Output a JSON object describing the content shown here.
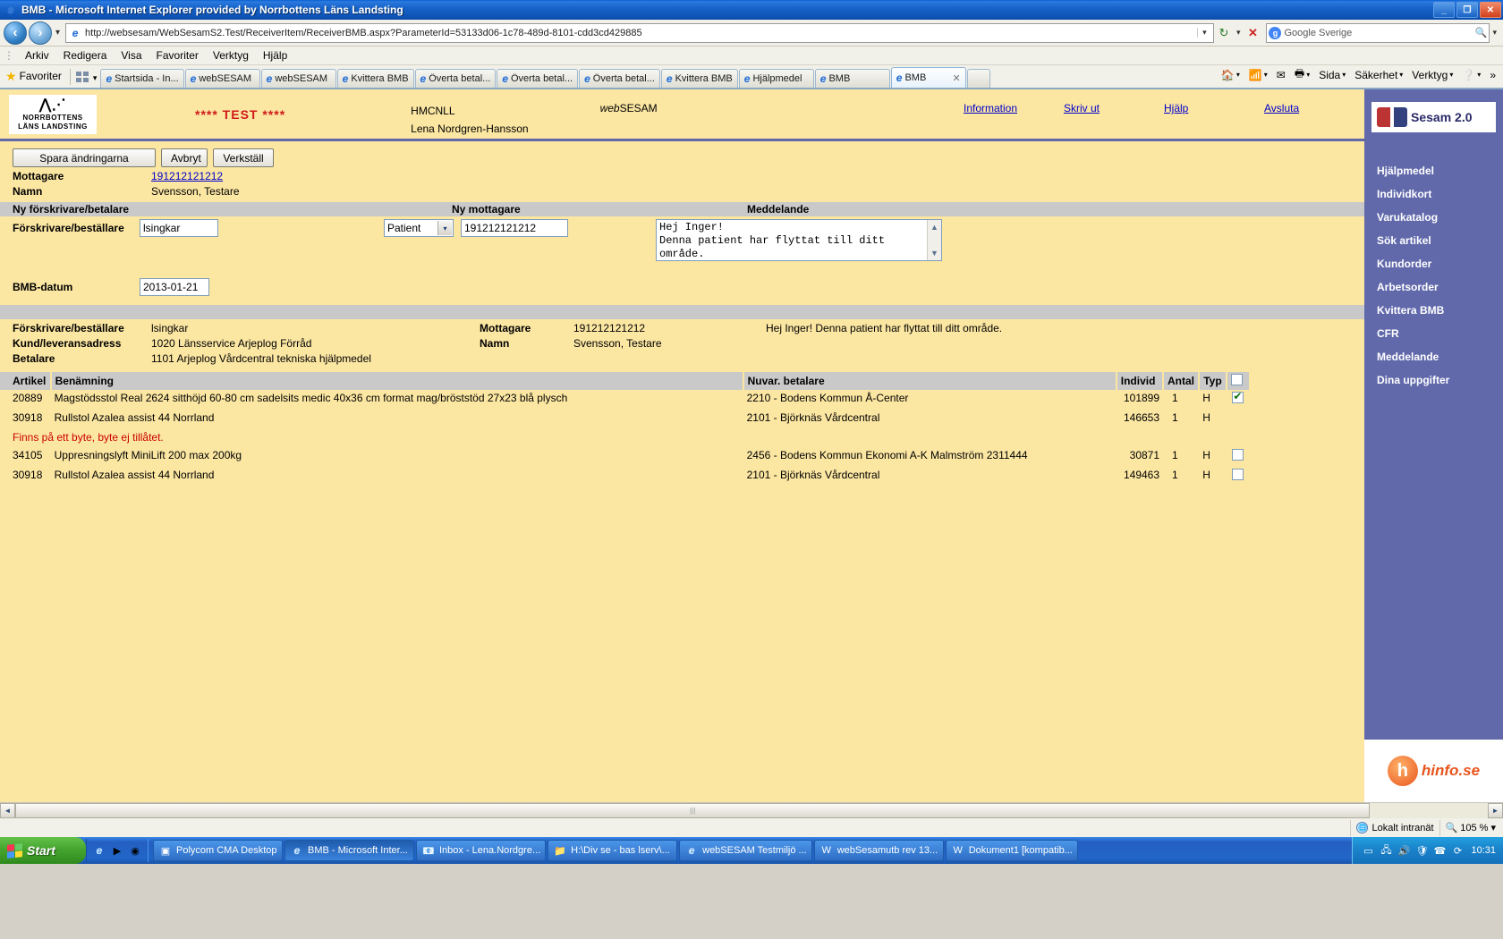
{
  "window": {
    "title": "BMB - Microsoft Internet Explorer provided by Norrbottens Läns Landsting",
    "icon": "ie-icon",
    "minimize": "_",
    "maximize": "❐",
    "close": "✕"
  },
  "address_bar": {
    "back_icon": "back-arrow-icon",
    "forward_icon": "forward-arrow-icon",
    "history_caret": "▾",
    "url": "http://websesam/WebSesamS2.Test/ReceiverItem/ReceiverBMB.aspx?ParameterId=53133d06-1c78-489d-8101-cdd3cd429885",
    "url_chevron": "▾",
    "refresh_icon": "refresh-icon",
    "stop_icon": "✕",
    "search_placeholder": "Google Sverige",
    "search_engine_badge": "g",
    "search_icon": "🔍"
  },
  "menu": {
    "items": [
      "Arkiv",
      "Redigera",
      "Visa",
      "Favoriter",
      "Verktyg",
      "Hjälp"
    ]
  },
  "favorites_bar": {
    "label": "Favoriter",
    "star_icon": "star-icon",
    "grid_icon": "grid-icon",
    "caret": "▾"
  },
  "tabs": [
    {
      "label": "Startsida - In...",
      "active": false
    },
    {
      "label": "webSESAM",
      "active": false
    },
    {
      "label": "webSESAM",
      "active": false
    },
    {
      "label": "Kvittera BMB",
      "active": false
    },
    {
      "label": "Överta betal...",
      "active": false
    },
    {
      "label": "Överta betal...",
      "active": false
    },
    {
      "label": "Överta betal...",
      "active": false
    },
    {
      "label": "Kvittera BMB",
      "active": false
    },
    {
      "label": "Hjälpmedel",
      "active": false
    },
    {
      "label": "BMB",
      "active": false
    },
    {
      "label": "BMB",
      "active": true,
      "close": "✕"
    }
  ],
  "tab_toolbar": {
    "home_icon": "home-icon",
    "feeds_icon": "rss-icon",
    "mail_icon": "mail-icon",
    "print_icon": "printer-icon",
    "caret": "▾",
    "page_menu": "Sida",
    "safety_menu": "Säkerhet",
    "tools_menu": "Verktyg",
    "help_icon": "help-icon",
    "overflow": "»"
  },
  "app_header": {
    "logo_line1": "NORRBOTTENS",
    "logo_line2": "LÄNS LANDSTING",
    "test_banner": "**** TEST ****",
    "org_code": "HMCNLL",
    "user_name": "Lena Nordgren-Hansson",
    "product_prefix": "web",
    "product_suffix": "SESAM",
    "links": [
      "Information",
      "Skriv ut",
      "Hjälp",
      "Avsluta"
    ]
  },
  "toolbar": {
    "save_label": "Spara ändringarna",
    "cancel_label": "Avbryt",
    "apply_label": "Verkställ"
  },
  "receiver": {
    "mottagare_label": "Mottagare",
    "mottagare_value": "191212121212",
    "namn_label": "Namn",
    "namn_value": "Svensson, Testare"
  },
  "section_headers": {
    "new_prescriber": "Ny förskrivare/betalare",
    "new_receiver": "Ny mottagare",
    "message": "Meddelande"
  },
  "form": {
    "prescriber_label": "Förskrivare/beställare",
    "prescriber_value": "lsingkar",
    "receiver_type_value": "Patient",
    "receiver_type_options": [
      "Patient"
    ],
    "receiver_id_value": "191212121212",
    "message_value": "Hej Inger!\nDenna patient har flyttat till ditt\nområde.",
    "bmb_date_label": "BMB-datum",
    "bmb_date_value": "2013-01-21",
    "select_caret": "▾",
    "scroll_up": "▲",
    "scroll_down": "▼"
  },
  "summary": {
    "prescriber_label": "Förskrivare/beställare",
    "prescriber_value": "lsingkar",
    "customer_label": "Kund/leveransadress",
    "customer_value": "1020 Länsservice Arjeplog Förråd",
    "payer_label": "Betalare",
    "payer_value": "1101 Arjeplog Vårdcentral tekniska hjälpmedel",
    "receiver_label": "Mottagare",
    "receiver_value": "191212121212",
    "name_label": "Namn",
    "name_value": "Svensson, Testare",
    "message_value": "Hej Inger! Denna patient har flyttat till ditt område."
  },
  "table": {
    "columns": [
      "Artikel",
      "Benämning",
      "Nuvar. betalare",
      "Individ",
      "Antal",
      "Typ",
      ""
    ],
    "header_checkbox": false,
    "rows": [
      {
        "artikel": "20889",
        "benamning": "Magstödsstol Real 2624 sitthöjd 60-80 cm sadelsits medic 40x36 cm format mag/bröststöd 27x23 blå plysch",
        "betalare": "2210 - Bodens Kommun Å-Center",
        "individ": "101899",
        "antal": "1",
        "typ": "H",
        "checked": true,
        "error": ""
      },
      {
        "artikel": "30918",
        "benamning": "Rullstol Azalea assist 44 Norrland",
        "betalare": "2101 - Björknäs Vårdcentral",
        "individ": "146653",
        "antal": "1",
        "typ": "H",
        "checked": null,
        "error": "Finns på ett byte, byte ej tillåtet."
      },
      {
        "artikel": "34105",
        "benamning": "Uppresningslyft MiniLift 200 max 200kg",
        "betalare": "2456 - Bodens Kommun Ekonomi A-K Malmström 2311444",
        "individ": "30871",
        "antal": "1",
        "typ": "H",
        "checked": false,
        "error": ""
      },
      {
        "artikel": "30918",
        "benamning": "Rullstol Azalea assist 44 Norrland",
        "betalare": "2101 - Björknäs Vårdcentral",
        "individ": "149463",
        "antal": "1",
        "typ": "H",
        "checked": false,
        "error": ""
      }
    ]
  },
  "sidebar": {
    "brand": "Sesam 2.0",
    "items": [
      "Hjälpmedel",
      "Individkort",
      "Varukatalog",
      "Sök artikel",
      "Kundorder",
      "Arbetsorder",
      "Kvittera BMB",
      "CFR",
      "Meddelande",
      "Dina uppgifter"
    ],
    "footer_logo": "hinfo.se",
    "footer_mark": "h"
  },
  "scrollbar": {
    "left_arrow": "◄",
    "right_arrow": "►",
    "grip": "|||"
  },
  "statusbar": {
    "zone_text": "Lokalt intranät",
    "zone_icon": "globe-icon",
    "zoom_level": "105 %",
    "zoom_caret": "▾",
    "resize_grip": "grip-icon"
  },
  "taskbar": {
    "start_label": "Start",
    "quick_icons": [
      "ie-quick-icon",
      "media-icon",
      "firefox-icon"
    ],
    "tasks": [
      {
        "label": "Polycom CMA Desktop",
        "icon": "polycom-icon",
        "selected": false
      },
      {
        "label": "BMB - Microsoft Inter...",
        "icon": "ie-icon",
        "selected": true
      },
      {
        "label": "Inbox - Lena.Nordgre...",
        "icon": "outlook-icon",
        "selected": false
      },
      {
        "label": "H:\\Div se - bas lserv\\...",
        "icon": "folder-icon",
        "selected": false
      },
      {
        "label": "webSESAM Testmiljö ...",
        "icon": "ie-icon",
        "selected": false
      },
      {
        "label": "webSesamutb rev 13...",
        "icon": "word-icon",
        "selected": false
      },
      {
        "label": "Dokument1 [kompatib...",
        "icon": "word-icon",
        "selected": false
      }
    ],
    "tray_icons": [
      "show-desktop-icon",
      "network-icon",
      "volume-icon",
      "shield-icon",
      "phone-icon",
      "sync-icon"
    ],
    "clock": "10:31"
  }
}
